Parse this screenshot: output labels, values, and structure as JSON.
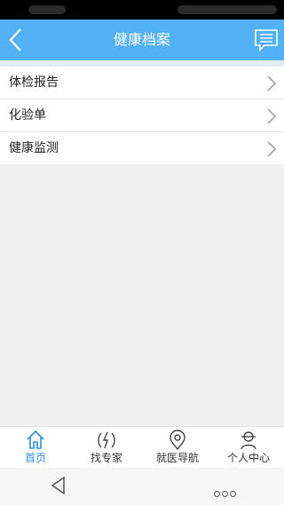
{
  "header": {
    "title": "健康档案",
    "back_icon": "chevron-left-icon",
    "message_icon": "message-list-icon"
  },
  "menu": {
    "items": [
      {
        "label": "体检报告"
      },
      {
        "label": "化验单"
      },
      {
        "label": "健康监测"
      }
    ]
  },
  "tabbar": {
    "active_color": "#2d8fe2",
    "tabs": [
      {
        "label": "首页",
        "icon": "home-icon",
        "active": true
      },
      {
        "label": "找专家",
        "icon": "expert-icon",
        "active": false
      },
      {
        "label": "就医导航",
        "icon": "location-pin-icon",
        "active": false
      },
      {
        "label": "个人中心",
        "icon": "person-icon",
        "active": false
      }
    ]
  },
  "colors": {
    "header_bg": "#52b0f5",
    "page_bg": "#f0f0f0"
  }
}
